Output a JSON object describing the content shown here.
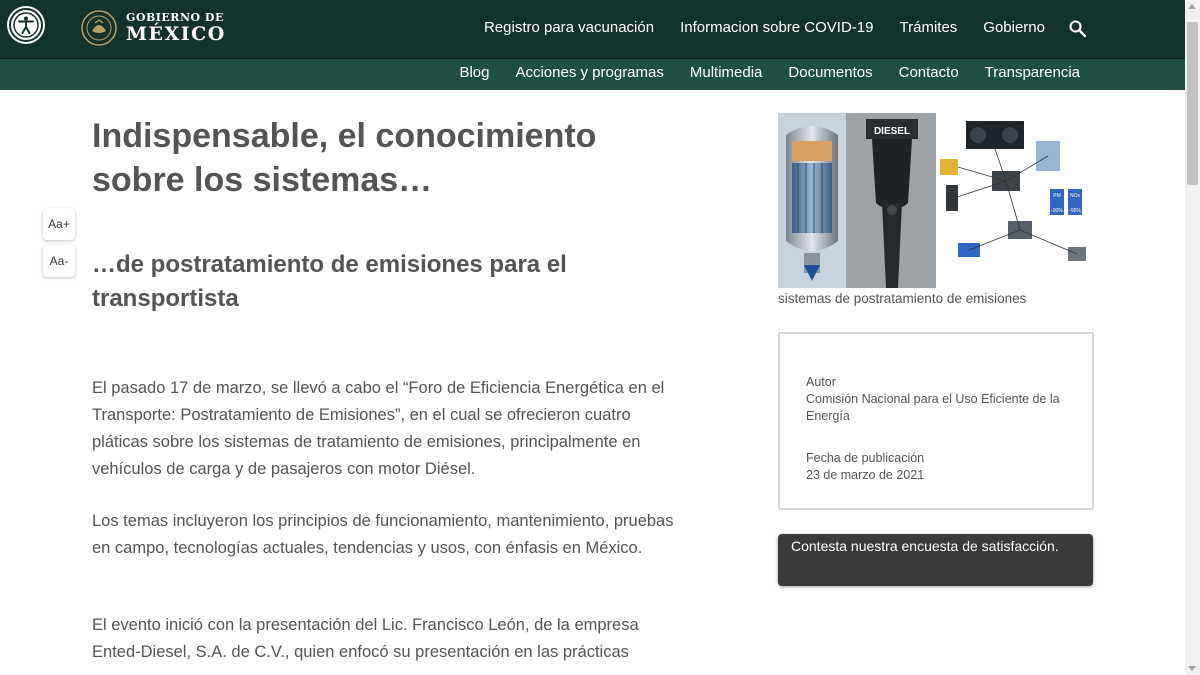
{
  "header": {
    "logo_line1": "GOBIERNO DE",
    "logo_line2": "MÉXICO",
    "nav": [
      "Registro para vacunación",
      "Informacion sobre COVID-19",
      "Trámites",
      "Gobierno"
    ]
  },
  "subnav": [
    "Blog",
    "Acciones y programas",
    "Multimedia",
    "Documentos",
    "Contacto",
    "Transparencia"
  ],
  "font_controls": {
    "increase": "Aa+",
    "decrease": "Aa-"
  },
  "article": {
    "title": "Indispensable, el conocimiento sobre los sistemas…",
    "subtitle": "…de postratamiento de emisiones para el transportista",
    "paragraphs": [
      "El pasado 17 de marzo, se llevó a cabo el “Foro de Eficiencia Energética en el Transporte: Postratamiento de Emisiones”, en el cual se ofrecieron cuatro pláticas sobre los sistemas de tratamiento de emisiones, principalmente en vehículos de carga y de pasajeros con motor Diésel.",
      "Los temas incluyeron los principios de funcionamiento, mantenimiento, pruebas en campo, tecnologías actuales, tendencias y usos, con énfasis en México.",
      "El evento inició con la presentación del Lic. Francisco León, de la empresa Ented-Diesel, S.A. de C.V., quien enfocó su presentación en las prácticas"
    ]
  },
  "sidebar": {
    "image_label": "DIESEL",
    "image_badges": [
      "PM",
      "NOx",
      "-90%",
      "-95%"
    ],
    "caption": "sistemas de postratamiento de emisiones",
    "author_label": "Autor",
    "author_value": "Comisión Nacional para el Uso Eficiente de la Energía",
    "date_label": "Fecha de publicación",
    "date_value": "23 de marzo de 2021",
    "survey": "Contesta nuestra encuesta de satisfacción."
  },
  "colors": {
    "header_bg": "#13322b",
    "subnav_bg": "#1e4f45",
    "text": "#545454",
    "survey_bg": "#3a3a3a"
  },
  "icons": [
    "accessibility-icon",
    "government-seal-icon",
    "search-icon"
  ]
}
